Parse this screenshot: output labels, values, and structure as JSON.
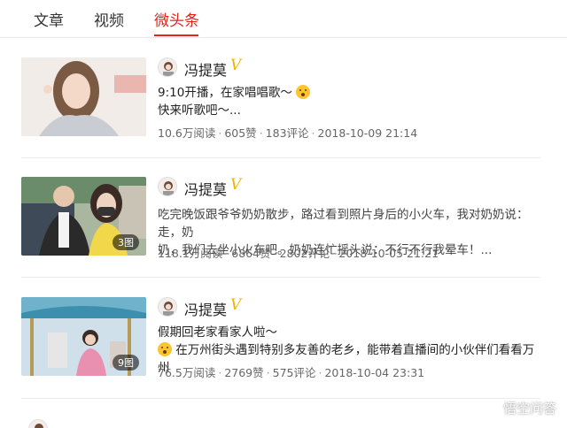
{
  "tabs": [
    {
      "label": "文章",
      "active": false
    },
    {
      "label": "视频",
      "active": false
    },
    {
      "label": "微头条",
      "active": true
    }
  ],
  "colors": {
    "accent": "#e2231a",
    "verified": "#f0b400"
  },
  "feed": [
    {
      "author": "冯提莫",
      "verified": "V",
      "text_line1": "9:10开播，在家唱唱歌～",
      "text_line2": "快来听歌吧～...",
      "reads": "10.6万阅读",
      "likes": "605赞",
      "comments": "183评论",
      "time": "2018-10-09 21:14",
      "image_count": ""
    },
    {
      "author": "冯提莫",
      "verified": "V",
      "text_line1": "吃完晚饭跟爷爷奶奶散步，路过看到照片身后的小火车，我对奶奶说：走，奶",
      "text_line2": "奶，我们去坐小火车吧。奶奶连忙摇头说：不行不行我晕车！...",
      "reads": "118.1万阅读",
      "likes": "6864赞",
      "comments": "2802评论",
      "time": "2018-10-05 21:21",
      "image_count": "3图"
    },
    {
      "author": "冯提莫",
      "verified": "V",
      "text_line1": "假期回老家看家人啦～",
      "text_line2": "在万州街头遇到特别多友善的老乡，能带着直播间的小伙伴们看看万州",
      "reads": "76.5万阅读",
      "likes": "2769赞",
      "comments": "575评论",
      "time": "2018-10-04 23:31",
      "image_count": "9图"
    }
  ],
  "watermark": "悟空问答",
  "meta_separator": "·"
}
